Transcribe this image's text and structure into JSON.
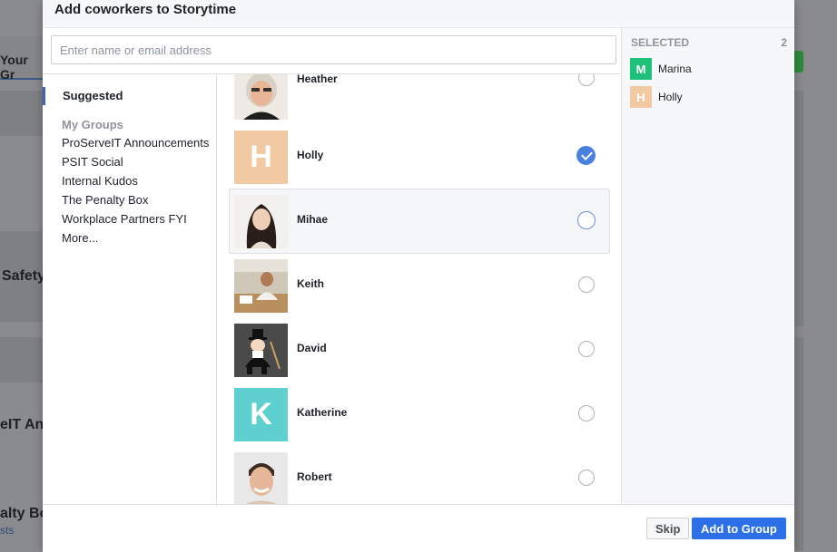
{
  "background": {
    "tab_label": "Your Gr",
    "snippets": [
      "Safety",
      "eIT Ann",
      "alty Bo"
    ],
    "link_text": "sts"
  },
  "dialog": {
    "title": "Add coworkers to Storytime",
    "search_placeholder": "Enter name or email address"
  },
  "nav": {
    "suggested_label": "Suggested",
    "groups_heading": "My Groups",
    "groups": [
      "ProServeIT Announcements",
      "PSIT Social",
      "Internal Kudos",
      "The Penalty Box",
      "Workplace Partners FYI",
      "More..."
    ]
  },
  "people": [
    {
      "name": "Heather",
      "state": "unchecked"
    },
    {
      "name": "Holly",
      "initial": "H",
      "avatar_color": "#f1c9a2",
      "state": "checked"
    },
    {
      "name": "Mihae",
      "state": "hover"
    },
    {
      "name": "Keith",
      "state": "unchecked"
    },
    {
      "name": "David",
      "state": "unchecked"
    },
    {
      "name": "Katherine",
      "initial": "K",
      "avatar_color": "#5fd0cf",
      "state": "unchecked"
    },
    {
      "name": "Robert",
      "state": "unchecked"
    }
  ],
  "selected": {
    "heading": "SELECTED",
    "count": "2",
    "items": [
      {
        "name": "Marina",
        "initial": "M",
        "color": "#1ec07a"
      },
      {
        "name": "Holly",
        "initial": "H",
        "color": "#f1c9a2"
      }
    ]
  },
  "footer": {
    "skip_label": "Skip",
    "add_label": "Add to Group"
  }
}
